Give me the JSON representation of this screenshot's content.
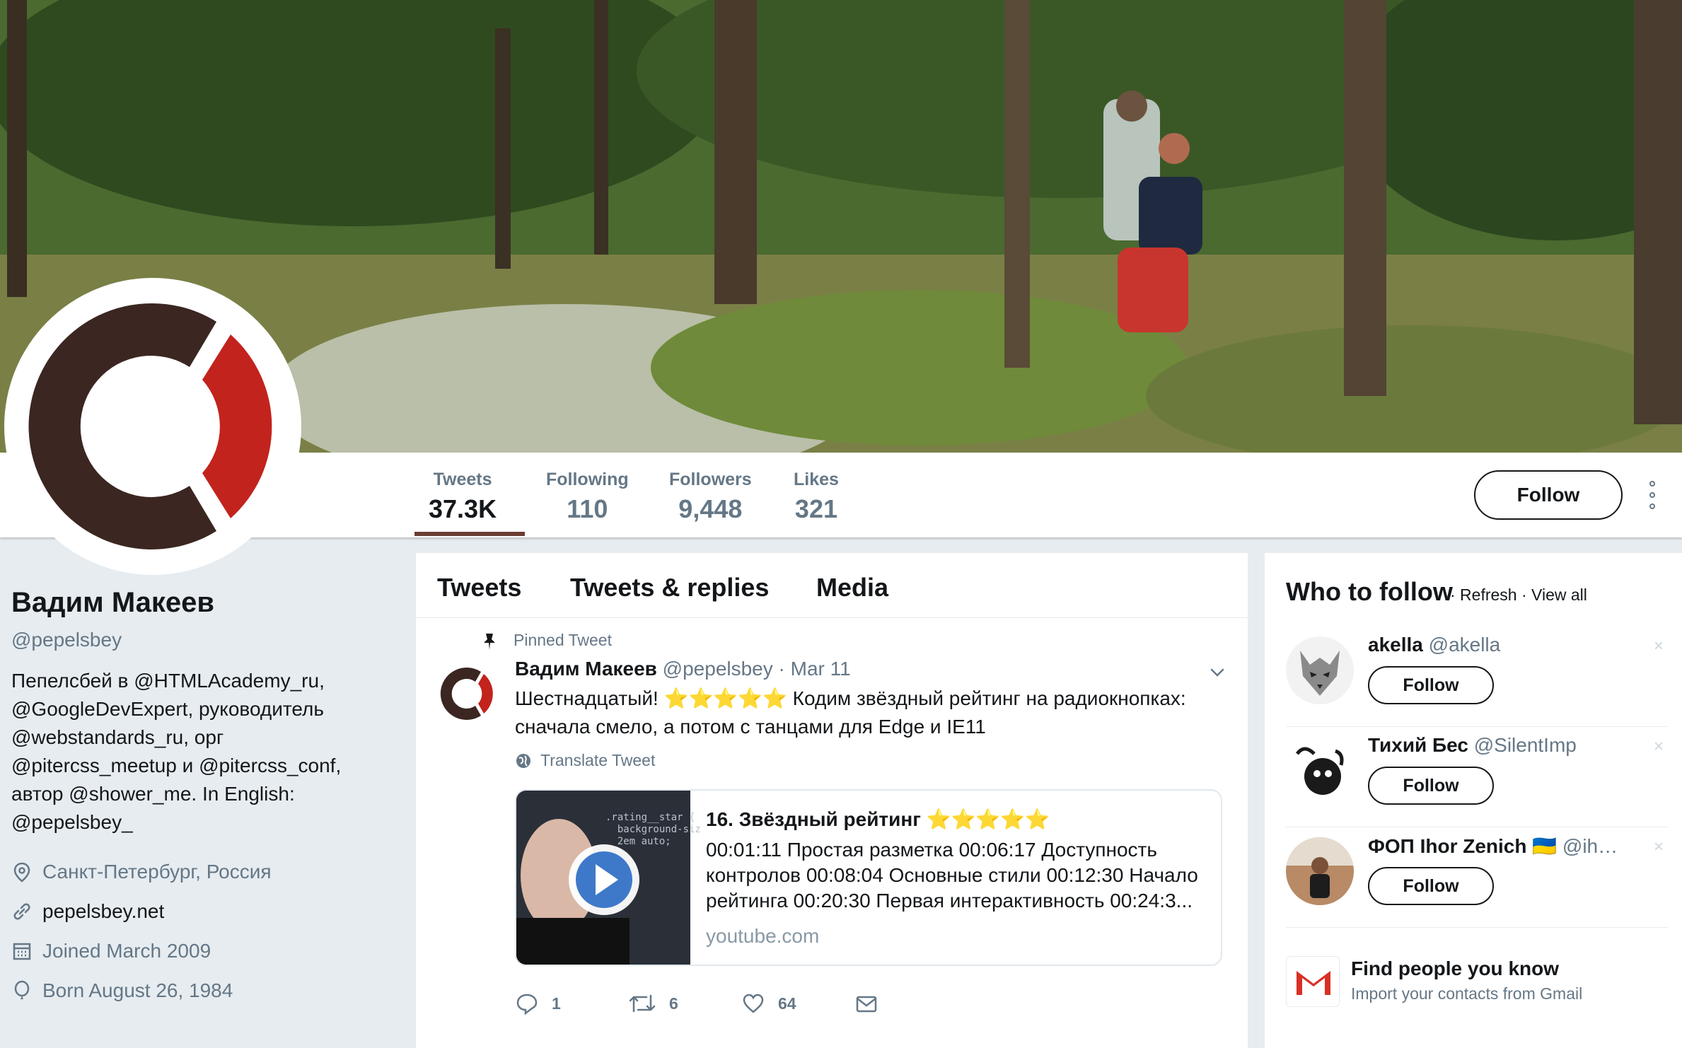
{
  "profile": {
    "name": "Вадим Макеев",
    "handle": "@pepelsbey",
    "bio_parts": [
      "Пепелсбей в ",
      "@HTMLAcademy_ru",
      ",",
      "@GoogleDevExpert",
      ", руководитель",
      "@webstandards_ru",
      ", орг",
      "@pitercss_meetup",
      " и ",
      "@pitercss_conf",
      ",",
      "автор ",
      "@shower_me",
      ". In English:",
      "@pepelsbey_"
    ],
    "location": "Санкт-Петербург, Россия",
    "website": "pepelsbey.net",
    "joined": "Joined March 2009",
    "born": "Born August 26, 1984"
  },
  "stats": [
    {
      "label": "Tweets",
      "value": "37.3K"
    },
    {
      "label": "Following",
      "value": "110"
    },
    {
      "label": "Followers",
      "value": "9,448"
    },
    {
      "label": "Likes",
      "value": "321"
    }
  ],
  "header": {
    "follow_label": "Follow"
  },
  "tabs": [
    "Tweets",
    "Tweets & replies",
    "Media"
  ],
  "tweet": {
    "pinned_label": "Pinned Tweet",
    "author": "Вадим Макеев",
    "handle": "@pepelsbey",
    "date": "· Mar 11",
    "text_a": "Шестнадцатый! ⭐⭐⭐⭐⭐ Кодим звёздный рейтинг на радиокнопках:",
    "text_b": "сначала смело, а потом с танцами для Edge и IE11",
    "translate_label": "Translate Tweet",
    "card": {
      "title": "16. Звёздный рейтинг ⭐⭐⭐⭐⭐",
      "description": "00:01:11 Простая разметка 00:06:17 Доступность контролов 00:08:04 Основные стили 00:12:30 Начало рейтинга 00:20:30 Первая интерактивность 00:24:3...",
      "source": "youtube.com",
      "thumb_code": ".rating__star {\n  background-siz\n  2em auto;"
    },
    "replies": "1",
    "retweets": "6",
    "likes": "64"
  },
  "who_to_follow": {
    "title": "Who to follow",
    "refresh": "· Refresh",
    "view_all": "· View all",
    "follow_label": "Follow",
    "close_glyph": "×",
    "suggestions": [
      {
        "name": "akella",
        "handle": "@akella"
      },
      {
        "name": "Тихий Бес",
        "handle": "@SilentImp"
      },
      {
        "name": "ФОП Ihor Zenich",
        "handle": "🇺🇦 @ih…"
      }
    ],
    "find_title": "Find people you know",
    "find_subtitle": "Import your contacts from Gmail"
  },
  "colors": {
    "brand_dark": "#3b2621",
    "brand_red": "#c2231d",
    "text": "#14171a",
    "muted": "#657786",
    "star": "#f5a623"
  }
}
